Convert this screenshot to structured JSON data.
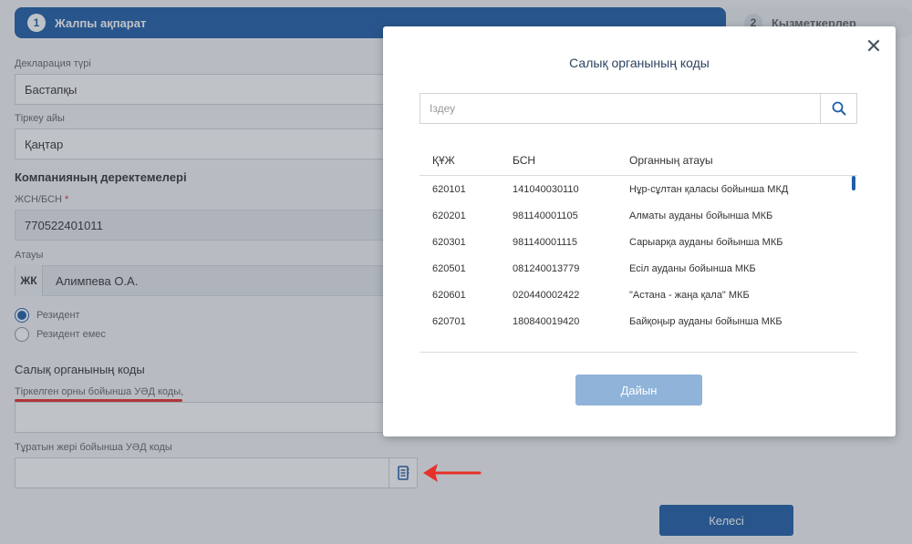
{
  "stepper": {
    "step1": {
      "num": "1",
      "label": "Жалпы ақпарат"
    },
    "step2": {
      "num": "2",
      "label": "Қызметкерлер"
    }
  },
  "form": {
    "declaration_type": {
      "label": "Декларация түрі",
      "value": "Бастапқы"
    },
    "reg_month": {
      "label": "Тіркеу айы",
      "value": "Қаңтар"
    },
    "company_section": "Компанияның деректемелері",
    "iin": {
      "label": "ЖСН/БСН",
      "required_mark": "*",
      "value": "770522401011"
    },
    "name": {
      "label": "Атауы",
      "prefix": "ЖК",
      "value": "Алимпева О.А."
    },
    "resident_options": [
      "Резидент",
      "Резидент емес"
    ],
    "tax_section": "Салық органының коды",
    "reg_place_code": {
      "label": "Тіркелген орны бойынша УӘД коды,",
      "value": ""
    },
    "residence_code": {
      "label": "Тұратын жері бойынша УӘД коды",
      "value": ""
    },
    "next_label": "Келесі"
  },
  "modal": {
    "title": "Салық органының коды",
    "search_placeholder": "Іздеу",
    "columns": [
      "ҚҰЖ",
      "БСН",
      "Органның атауы"
    ],
    "rows": [
      {
        "code": "620101",
        "bin": "141040030110",
        "name": "Нұр-сұлтан қаласы бойынша МКД"
      },
      {
        "code": "620201",
        "bin": "981140001105",
        "name": "Алматы ауданы бойынша МКБ"
      },
      {
        "code": "620301",
        "bin": "981140001115",
        "name": "Сарыарқа ауданы бойынша МКБ"
      },
      {
        "code": "620501",
        "bin": "081240013779",
        "name": "Есіл ауданы бойынша МКБ"
      },
      {
        "code": "620601",
        "bin": "020440002422",
        "name": "\"Астана - жаңа қала\" МКБ"
      },
      {
        "code": "620701",
        "bin": "180840019420",
        "name": "Байқоңыр ауданы бойынша МКБ"
      }
    ],
    "done_label": "Дайын",
    "close_glyph": "✕"
  },
  "colors": {
    "primary": "#1f5ea8",
    "annotation": "#e8302b"
  }
}
